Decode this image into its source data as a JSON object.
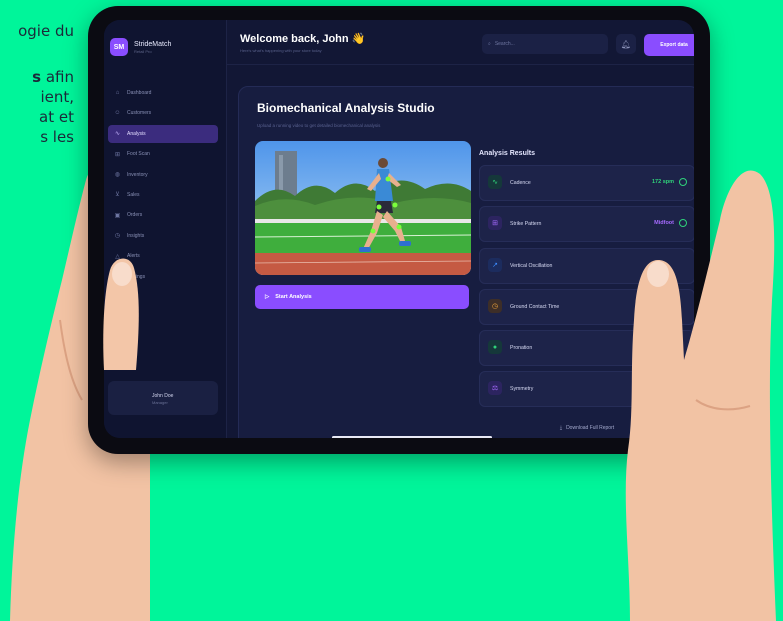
{
  "page_text": {
    "line1": "ogie du",
    "line2_bold": "s",
    "line2_rest": " afin",
    "line3": "ient,",
    "line4": "at et",
    "line5": "s les"
  },
  "app": {
    "brand_name": "StrideMatch",
    "brand_sub": "Retail Pro",
    "logo_text": "SM"
  },
  "sidebar": {
    "items": [
      {
        "label": "Dashboard",
        "icon": "home-icon"
      },
      {
        "label": "Customers",
        "icon": "users-icon"
      },
      {
        "label": "Analysis",
        "icon": "activity-icon",
        "active": true
      },
      {
        "label": "Foot Scan",
        "icon": "foot-icon"
      },
      {
        "label": "Inventory",
        "icon": "box-icon"
      },
      {
        "label": "Sales",
        "icon": "cart-icon"
      },
      {
        "label": "Orders",
        "icon": "clipboard-icon"
      },
      {
        "label": "Insights",
        "icon": "clock-icon"
      },
      {
        "label": "Alerts",
        "icon": "bell-icon"
      },
      {
        "label": "Settings",
        "icon": "gear-icon"
      }
    ],
    "profile": {
      "name": "John Doe",
      "role": "Manager"
    }
  },
  "header": {
    "welcome": "Welcome back, John 👋",
    "subtitle": "Here's what's happening with your store today",
    "search_placeholder": "Search...",
    "export_label": "Export data"
  },
  "studio": {
    "title": "Biomechanical Analysis Studio",
    "subtitle": "Upload a running video to get detailed biomechanical analysis",
    "start_label": "Start Analysis",
    "results_title": "Analysis Results",
    "download_label": "Download Full Report"
  },
  "results": [
    {
      "label": "Cadence",
      "value": "172 spm",
      "icon": "pulse-icon",
      "color": "#2fd27a"
    },
    {
      "label": "Strike Pattern",
      "value": "Midfoot",
      "icon": "footprint-icon",
      "color": "#a66bff"
    },
    {
      "label": "Vertical Oscillation",
      "value": "",
      "icon": "trend-icon",
      "color": "#3b8cff"
    },
    {
      "label": "Ground Contact Time",
      "value": "",
      "icon": "clock-icon",
      "color": "#f0a43a"
    },
    {
      "label": "Pronation",
      "value": "",
      "icon": "dot-icon",
      "color": "#2fd27a"
    },
    {
      "label": "Symmetry",
      "value": "",
      "icon": "balance-icon",
      "color": "#a66bff"
    }
  ],
  "colors": {
    "background": "#00f59a",
    "accent": "#8a4dff",
    "panel": "#171d40"
  }
}
